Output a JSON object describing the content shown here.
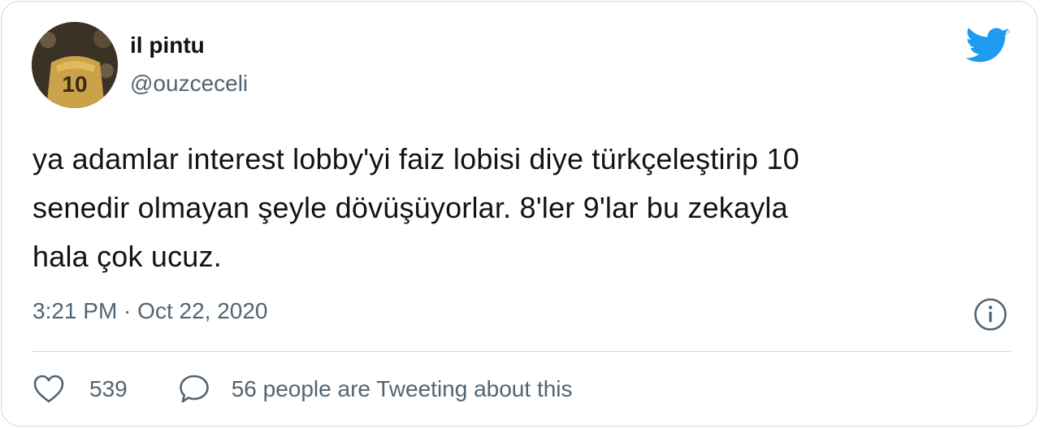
{
  "author": {
    "display_name": "il pintu",
    "handle": "@ouzceceli",
    "avatar_icon": "profile-photo-football-player-number-10",
    "avatar_jersey_number": "10"
  },
  "tweet": {
    "text_lines": [
      "ya adamlar interest lobby'yi faiz lobisi diye türkçeleştirip 10",
      "senedir olmayan şeyle dövüşüyorlar. 8'ler 9'lar bu zekayla",
      "hala çok ucuz."
    ],
    "timestamp": "3:21 PM · Oct 22, 2020"
  },
  "engagement": {
    "like_count": "539",
    "reply_text": "56 people are Tweeting about this"
  },
  "icons": {
    "brand": "twitter-bird-icon",
    "info": "info-icon",
    "like": "heart-icon",
    "reply": "speech-bubble-icon"
  },
  "colors": {
    "brand_blue": "#1d9bf0",
    "secondary_text": "#536471",
    "primary_text": "#0f1419",
    "border": "#cfd9de"
  }
}
